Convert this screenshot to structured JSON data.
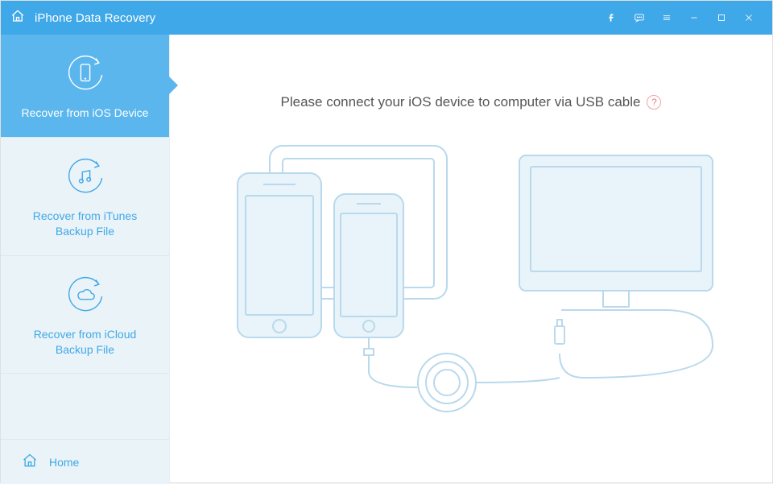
{
  "app": {
    "title": "iPhone Data Recovery"
  },
  "sidebar": {
    "items": [
      {
        "label": "Recover from iOS Device",
        "icon": "recover-ios-icon"
      },
      {
        "label": "Recover from iTunes Backup File",
        "icon": "recover-itunes-icon"
      },
      {
        "label": "Recover from iCloud Backup File",
        "icon": "recover-icloud-icon"
      }
    ],
    "active_index": 0,
    "home_label": "Home"
  },
  "main": {
    "prompt": "Please connect your iOS device to computer via USB cable",
    "help_symbol": "?"
  },
  "colors": {
    "accent": "#3fa8e8",
    "sidebar_bg": "#eaf3f8",
    "sidebar_active": "#5bb6ed",
    "illustration_stroke": "#b9d9ec"
  }
}
